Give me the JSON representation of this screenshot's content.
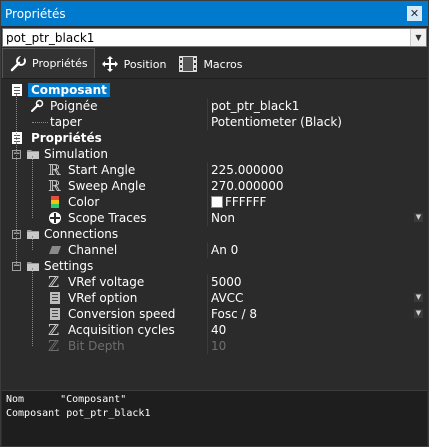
{
  "window": {
    "title": "Propriétés",
    "close_icon": "close-icon"
  },
  "combo": {
    "value": "pot_ptr_black1"
  },
  "tabs": [
    {
      "label": "Propriétés",
      "icon": "wrench-icon",
      "active": true
    },
    {
      "label": "Position",
      "icon": "move-arrows-icon",
      "active": false
    },
    {
      "label": "Macros",
      "icon": "film-icon",
      "active": false
    }
  ],
  "grid": {
    "categories": {
      "composant": "Composant",
      "proprietes": "Propriétés"
    },
    "composant_rows": [
      {
        "name": "Poignée",
        "value": "pot_ptr_black1"
      },
      {
        "name": "taper",
        "value": "Potentiometer (Black)"
      }
    ],
    "groups": {
      "simulation": "Simulation",
      "connections": "Connections",
      "settings": "Settings"
    },
    "simulation_rows": [
      {
        "name": "Start Angle",
        "value": "225.000000"
      },
      {
        "name": "Sweep Angle",
        "value": "270.000000"
      },
      {
        "name": "Color",
        "value": "FFFFFF"
      },
      {
        "name": "Scope Traces",
        "value": "Non"
      }
    ],
    "connections_rows": [
      {
        "name": "Channel",
        "value": "An 0"
      }
    ],
    "settings_rows": [
      {
        "name": "VRef voltage",
        "value": "5000"
      },
      {
        "name": "VRef option",
        "value": "AVCC"
      },
      {
        "name": "Conversion speed",
        "value": "Fosc / 8"
      },
      {
        "name": "Acquisition cycles",
        "value": "40"
      },
      {
        "name": "Bit Depth",
        "value": "10"
      }
    ]
  },
  "description": {
    "line1_key": "Nom",
    "line1_val": "\"Composant\"",
    "line2_key": "Composant",
    "line2_val": "pot_ptr_black1"
  },
  "colors": {
    "accent": "#007acc",
    "background": "#2b2b2b",
    "disabled_text": "#6e6e6e"
  }
}
